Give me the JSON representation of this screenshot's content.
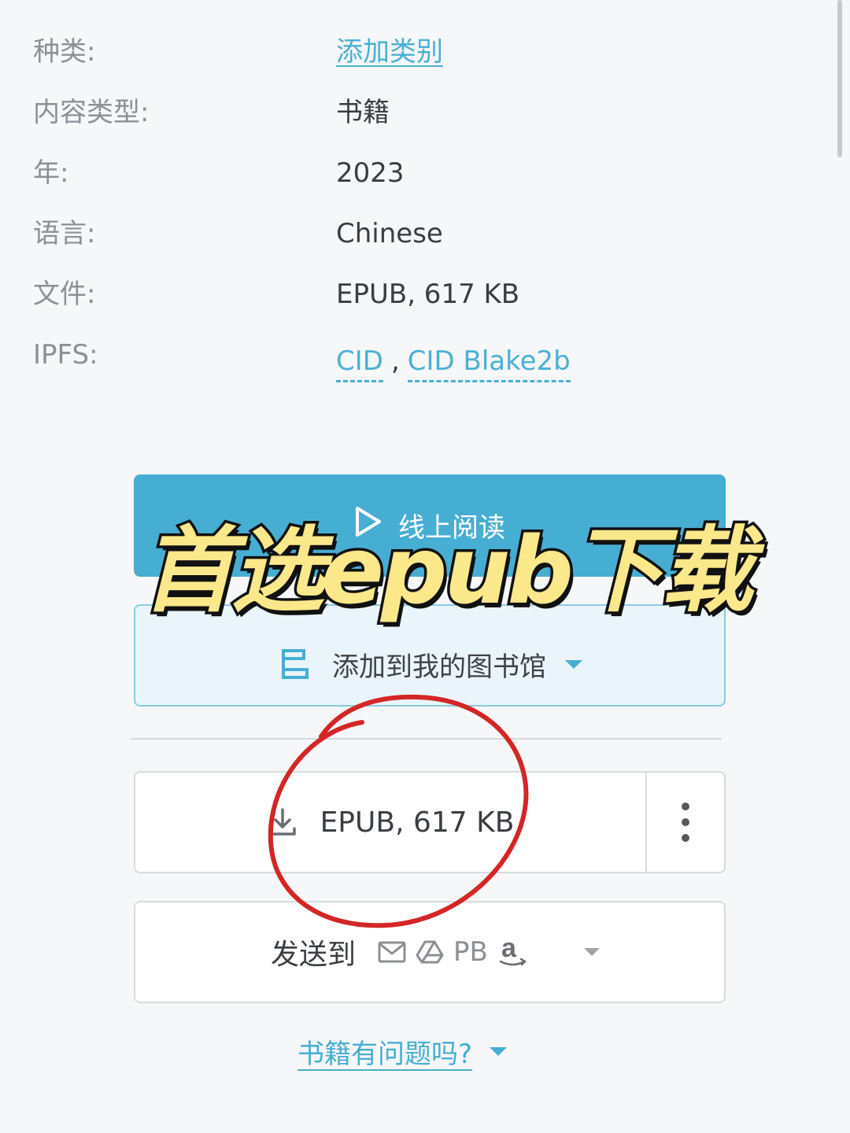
{
  "details": [
    {
      "label": "种类:",
      "value": "添加类别"
    },
    {
      "label": "内容类型:",
      "value": "书籍"
    },
    {
      "label": "年:",
      "value": "2023"
    },
    {
      "label": "语言:",
      "value": "Chinese"
    },
    {
      "label": "文件:",
      "value": "EPUB, 617 KB"
    }
  ],
  "ipfs": {
    "label": "IPFS:",
    "links": [
      "CID",
      "CID Blake2b"
    ],
    "separator": ","
  },
  "buttons": {
    "read_online": "线上阅读",
    "add_library": "添加到我的图书馆",
    "download": "EPUB, 617 KB",
    "send_to": "发送到",
    "send_targets": [
      "email-icon",
      "google-drive-icon",
      "PB",
      "amazon-icon"
    ],
    "problem": "书籍有问题吗?"
  },
  "overlay": {
    "title": "首选epub下载"
  },
  "colors": {
    "accent": "#47aed3",
    "annotation_red": "#d42626",
    "overlay_yellow": "#fbe88a"
  }
}
